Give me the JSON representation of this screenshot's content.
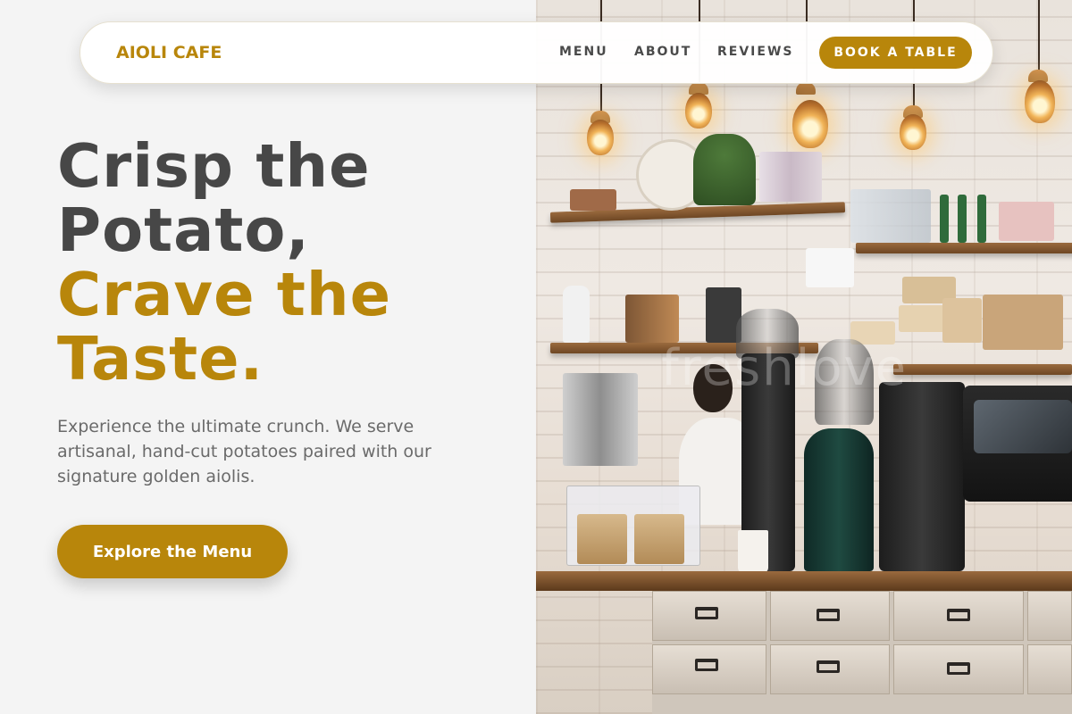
{
  "brand": {
    "name": "AIOLI CAFE",
    "color": "#b8860b"
  },
  "nav": {
    "items": [
      {
        "label": "MENU"
      },
      {
        "label": "ABOUT"
      },
      {
        "label": "REVIEWS"
      }
    ],
    "cta_label": "BOOK A TABLE"
  },
  "hero": {
    "title_line1": "Crisp the",
    "title_line2": "Potato,",
    "title_line3": "Crave the",
    "title_line4": "Taste.",
    "subtitle": "Experience the ultimate crunch. We serve artisanal, hand-cut potatoes paired with our signature golden aiolis.",
    "cta_label": "Explore the Menu"
  },
  "photo": {
    "watermark": "freshlove"
  },
  "colors": {
    "accent": "#b8860b",
    "heading": "#474747",
    "background": "#f4f4f4"
  }
}
